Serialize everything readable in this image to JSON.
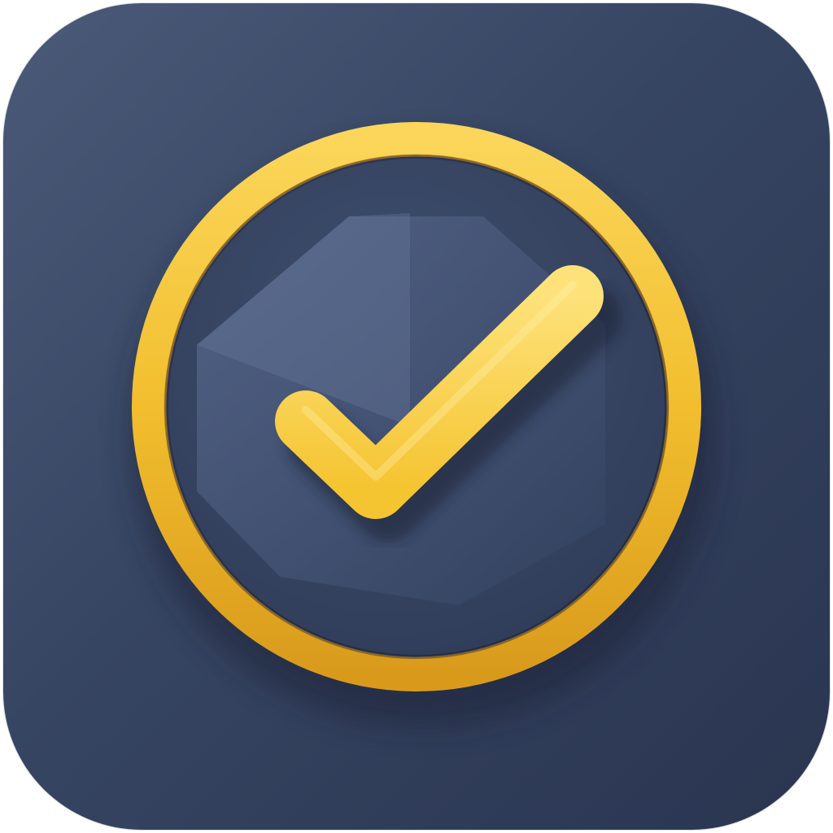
{
  "icon": {
    "name": "checkmark-app-icon",
    "symbol": "check-circle-icon"
  },
  "colors": {
    "tile_light": "#4a5a78",
    "tile_mid": "#364562",
    "tile_dark": "#2a3550",
    "ring": "#f2be2e",
    "ring_highlight": "#fbd65a",
    "ring_shadow": "#d99a1c",
    "inner_disc": "#2f3c58",
    "facet_light": "#56678a",
    "facet_dark": "#33415f",
    "check": "#f5c431",
    "check_highlight": "#fde27a"
  }
}
